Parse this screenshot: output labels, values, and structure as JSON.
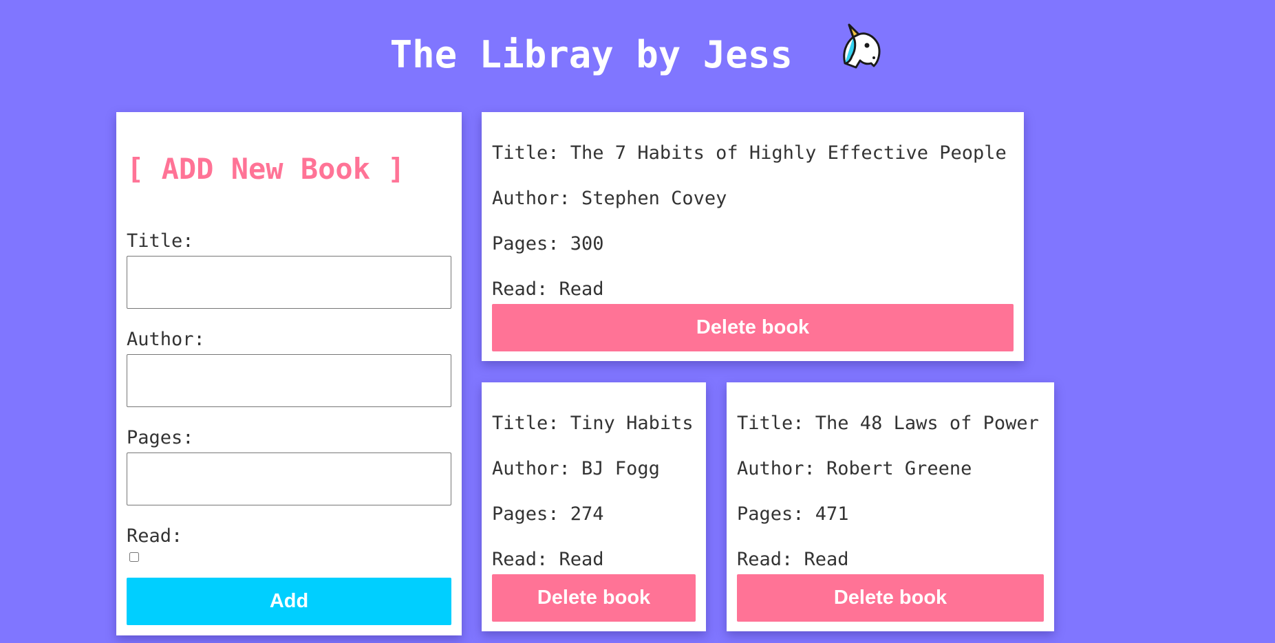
{
  "header": {
    "title": "The Libray by Jess",
    "emoji": "🦄"
  },
  "form": {
    "heading": "[ ADD New Book ]",
    "title_label": "Title:",
    "author_label": "Author:",
    "pages_label": "Pages:",
    "read_label": "Read:",
    "title_value": "",
    "author_value": "",
    "pages_value": "",
    "read_checked": false,
    "add_label": "Add"
  },
  "books": [
    {
      "title": "Title: The 7 Habits of Highly Effective People",
      "author": "Author: Stephen Covey",
      "pages": "Pages: 300",
      "read": "Read: Read",
      "delete_label": "Delete book"
    },
    {
      "title": "Title: Tiny Habits",
      "author": "Author: BJ Fogg",
      "pages": "Pages: 274",
      "read": "Read: Read",
      "delete_label": "Delete book"
    },
    {
      "title": "Title: The 48 Laws of Power",
      "author": "Author: Robert Greene",
      "pages": "Pages: 471",
      "read": "Read: Read",
      "delete_label": "Delete book"
    }
  ],
  "colors": {
    "background": "#8076ff",
    "accent_pink": "#ff7396",
    "accent_cyan": "#00cfff",
    "card": "#ffffff"
  }
}
